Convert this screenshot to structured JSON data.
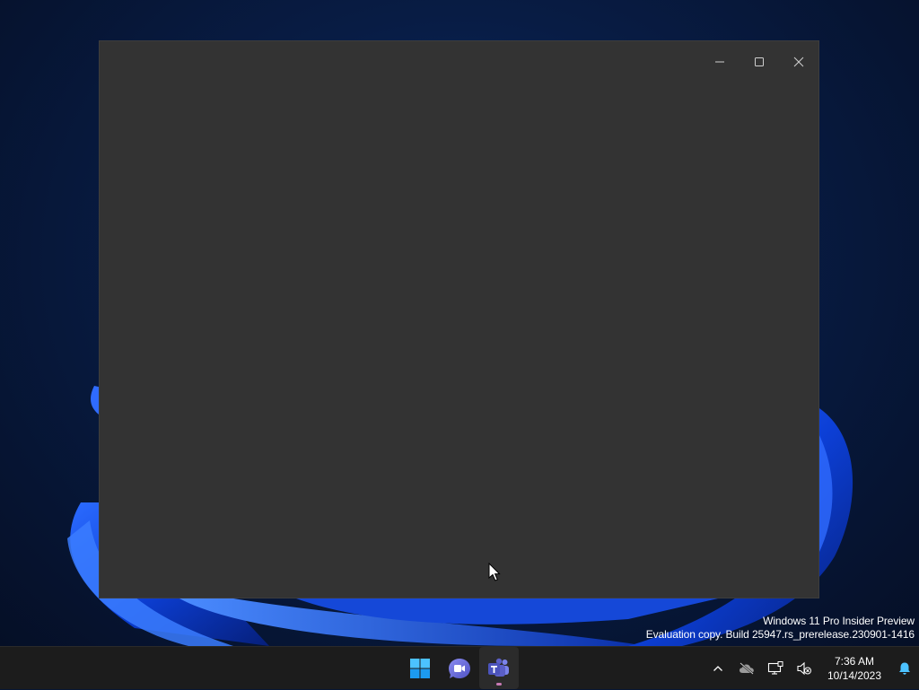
{
  "window": {
    "minimize_icon": "minimize-icon",
    "maximize_icon": "maximize-icon",
    "close_icon": "close-icon",
    "background": "#333333"
  },
  "watermark": {
    "line1": "Windows 11 Pro Insider Preview",
    "line2": "Evaluation copy. Build 25947.rs_prerelease.230901-1416"
  },
  "taskbar": {
    "apps": [
      {
        "name": "Start",
        "icon": "windows-logo-icon"
      },
      {
        "name": "Meet/Chat",
        "icon": "video-chat-icon"
      },
      {
        "name": "Teams",
        "icon": "teams-icon",
        "active": true
      }
    ],
    "tray": {
      "chevron_icon": "chevron-up-icon",
      "onedrive_icon": "cloud-offline-icon",
      "network_icon": "network-icon",
      "volume_icon": "volume-muted-icon",
      "notification_icon": "bell-icon"
    },
    "clock": {
      "time": "7:36 AM",
      "date": "10/14/2023"
    }
  },
  "colors": {
    "accent": "#0078d4",
    "taskbar": "#1c1c1c",
    "teams": "#5b5fc7"
  }
}
